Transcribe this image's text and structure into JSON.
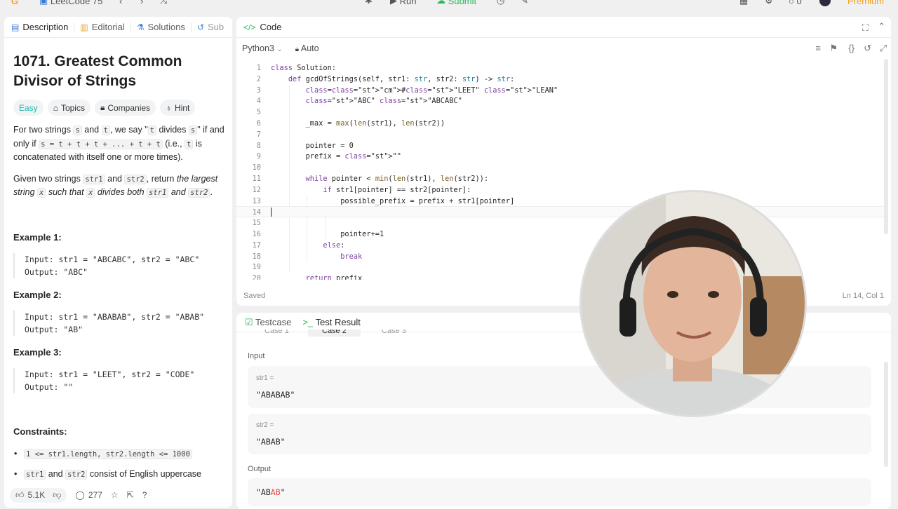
{
  "topbar": {
    "title": "LeetCode 75",
    "run": "Run",
    "submit": "Submit",
    "badge_count": "0",
    "premium": "Premium"
  },
  "left": {
    "tabs": [
      {
        "label": "Description"
      },
      {
        "label": "Editorial"
      },
      {
        "label": "Solutions"
      },
      {
        "label": "Sub"
      }
    ],
    "title": "1071. Greatest Common Divisor of Strings",
    "chips": {
      "difficulty": "Easy",
      "topics": "Topics",
      "companies": "Companies",
      "hint": "Hint"
    },
    "desc": {
      "p1a": "For two strings ",
      "s": "s",
      "p1b": " and ",
      "t": "t",
      "p1c": ", we say \"",
      "t2": "t",
      "p1d": " divides ",
      "s2": "s",
      "p1e": "\" if and only if ",
      "eq": "s = t + t + t + ... + t + t",
      "p1f": " (i.e., ",
      "t3": "t",
      "p1g": " is concatenated with itself one or more times).",
      "p2a": "Given two strings ",
      "str1": "str1",
      "p2b": " and ",
      "str2": "str2",
      "p2c": ", return ",
      "p2d": "the largest string ",
      "x": "x",
      "p2e": " such that ",
      "x2": "x",
      "p2f": " divides both ",
      "str1b": "str1",
      "p2g": " and ",
      "str2b": "str2",
      "p2h": "."
    },
    "examples": [
      {
        "heading": "Example 1:",
        "body": "Input: str1 = \"ABCABC\", str2 = \"ABC\"\nOutput: \"ABC\""
      },
      {
        "heading": "Example 2:",
        "body": "Input: str1 = \"ABABAB\", str2 = \"ABAB\"\nOutput: \"AB\""
      },
      {
        "heading": "Example 3:",
        "body": "Input: str1 = \"LEET\", str2 = \"CODE\"\nOutput: \"\""
      }
    ],
    "constraints": {
      "heading": "Constraints:",
      "c1": "1 <= str1.length, str2.length <= 1000",
      "c2a": "str1",
      "c2b": " and ",
      "c2c": "str2",
      "c2d": " consist of English uppercase"
    },
    "bottom": {
      "likes": "5.1K",
      "comments": "277"
    }
  },
  "code": {
    "header": "Code",
    "language": "Python3",
    "auto": "Auto",
    "status": "Saved",
    "cursor": "Ln 14, Col 1",
    "lines": [
      {
        "n": "1",
        "t": "class Solution:"
      },
      {
        "n": "2",
        "t": "    def gcdOfStrings(self, str1: str, str2: str) -> str:"
      },
      {
        "n": "3",
        "t": "        #\"LEET\" \"LEAN\""
      },
      {
        "n": "4",
        "t": "        \"ABC\" \"ABCABC\""
      },
      {
        "n": "5",
        "t": ""
      },
      {
        "n": "6",
        "t": "        _max = max(len(str1), len(str2))"
      },
      {
        "n": "7",
        "t": ""
      },
      {
        "n": "8",
        "t": "        pointer = 0"
      },
      {
        "n": "9",
        "t": "        prefix = \"\""
      },
      {
        "n": "10",
        "t": ""
      },
      {
        "n": "11",
        "t": "        while pointer < min(len(str1), len(str2)):"
      },
      {
        "n": "12",
        "t": "            if str1[pointer] == str2[pointer]:"
      },
      {
        "n": "13",
        "t": "                possible_prefix = prefix + str1[pointer]"
      },
      {
        "n": "14",
        "t": ""
      },
      {
        "n": "15",
        "t": ""
      },
      {
        "n": "16",
        "t": "                pointer+=1"
      },
      {
        "n": "17",
        "t": "            else:"
      },
      {
        "n": "18",
        "t": "                break"
      },
      {
        "n": "19",
        "t": ""
      },
      {
        "n": "20",
        "t": "        return prefix"
      }
    ]
  },
  "test": {
    "tabs": {
      "testcase": "Testcase",
      "result": "Test Result"
    },
    "cases": [
      "Case 1",
      "Case 2",
      "Case 3"
    ],
    "input_label": "Input",
    "inputs": [
      {
        "label": "str1 =",
        "value": "\"ABABAB\""
      },
      {
        "label": "str2 =",
        "value": "\"ABAB\""
      }
    ],
    "output_label": "Output",
    "output_value": "\"ABAB\""
  }
}
